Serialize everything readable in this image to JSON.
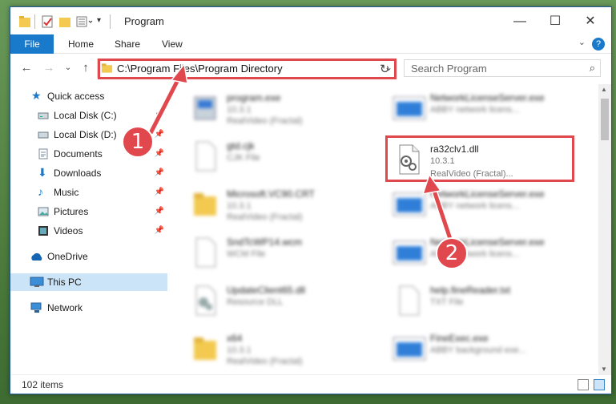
{
  "window": {
    "title": "Program"
  },
  "ribbon": {
    "file": "File",
    "tabs": [
      "Home",
      "Share",
      "View"
    ]
  },
  "address": {
    "path": "C:\\Program Files\\Program Directory"
  },
  "search": {
    "placeholder": "Search Program"
  },
  "sidebar": {
    "items": [
      {
        "label": "Quick access",
        "icon": "star-icon"
      },
      {
        "label": "Local Disk (C:)",
        "icon": "drive-icon",
        "pinned": true
      },
      {
        "label": "Local Disk (D:)",
        "icon": "drive-icon",
        "pinned": true
      },
      {
        "label": "Documents",
        "icon": "documents-icon",
        "pinned": true
      },
      {
        "label": "Downloads",
        "icon": "download-icon",
        "pinned": true
      },
      {
        "label": "Music",
        "icon": "music-icon",
        "pinned": true
      },
      {
        "label": "Pictures",
        "icon": "pictures-icon",
        "pinned": true
      },
      {
        "label": "Videos",
        "icon": "videos-icon",
        "pinned": true
      },
      {
        "label": "OneDrive",
        "icon": "cloud-icon"
      },
      {
        "label": "This PC",
        "icon": "pc-icon",
        "selected": true
      },
      {
        "label": "Network",
        "icon": "network-icon"
      }
    ]
  },
  "files": {
    "left": [
      {
        "name": "program.exe",
        "line1": "10.3.1",
        "line2": "RealVideo (Fractal)"
      },
      {
        "name": "gtd.cjk",
        "line1": "CJK File",
        "line2": ""
      },
      {
        "name": "Microsoft.VC90.CRT",
        "line1": "10.3.1",
        "line2": "RealVideo (Fractal)"
      },
      {
        "name": "SndTcWP14.wcm",
        "line1": "WCM File",
        "line2": ""
      },
      {
        "name": "UpdateClient65.dll",
        "line1": "Resource DLL",
        "line2": ""
      },
      {
        "name": "x64",
        "line1": "10.3.1",
        "line2": "RealVideo (Fractal)"
      }
    ],
    "right": [
      {
        "name": "NetworkLicenseServer.exe",
        "line1": "ABBY network licens...",
        "line2": ""
      },
      {
        "name": "ra32clv1.dll",
        "line1": "10.3.1",
        "line2": "RealVideo (Fractal)..."
      },
      {
        "name": "NetworkLicenseServer.exe",
        "line1": "ABBY network licens...",
        "line2": ""
      },
      {
        "name": "NetworkLicenseServer.exe",
        "line1": "ABBY network licens...",
        "line2": ""
      },
      {
        "name": "help.fineReader.txt",
        "line1": "TXT File",
        "line2": ""
      },
      {
        "name": "FineExec.exe",
        "line1": "ABBY background exe...",
        "line2": ""
      }
    ]
  },
  "status": {
    "items": "102 items"
  },
  "callouts": {
    "one": "1",
    "two": "2"
  },
  "colors": {
    "accent": "#1979ca",
    "callout": "#e0484e",
    "selected": "#cce4f7"
  }
}
